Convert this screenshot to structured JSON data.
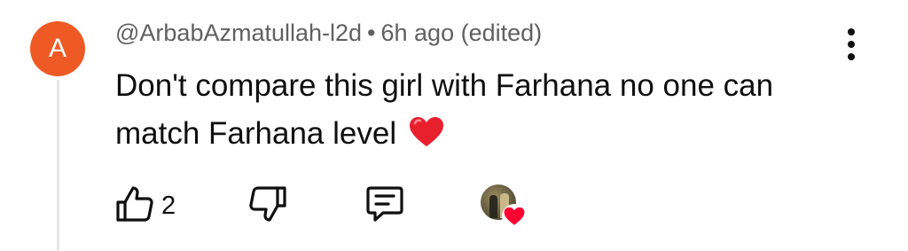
{
  "comment": {
    "avatar_letter": "A",
    "avatar_color": "#ef5a24",
    "author": "@ArbabAzmatullah-l2d",
    "separator": "•",
    "time": "6h ago (edited)",
    "text": "Don't compare this girl with Farhana no one can match Farhana level",
    "emoji": "red-heart-emoji",
    "like_count": "2"
  },
  "icons": {
    "more": "vertical-ellipsis-icon",
    "like": "thumbs-up-icon",
    "dislike": "thumbs-down-icon",
    "reply": "comment-reply-icon",
    "creator_heart": "creator-heart-icon"
  },
  "colors": {
    "text_primary": "#0f0f0f",
    "text_secondary": "#606060",
    "heart_red": "#ff0033"
  }
}
